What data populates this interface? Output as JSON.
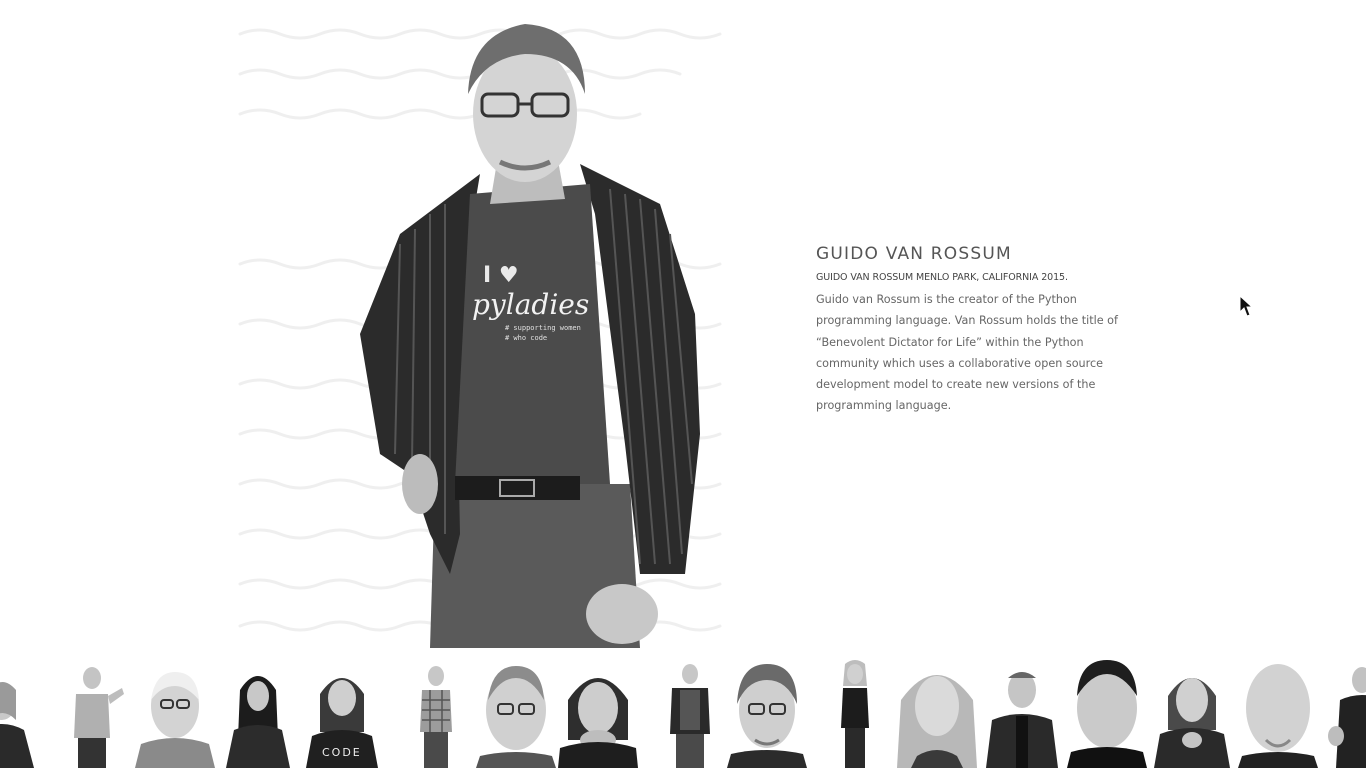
{
  "profile": {
    "name": "GUIDO VAN ROSSUM",
    "caption": "GUIDO VAN ROSSUM MENLO PARK, CALIFORNIA 2015.",
    "bio": "Guido van Rossum is the creator of the Python programming language. Van Rossum holds the title of “Benevolent Dictator for Life” within the Python community which uses a collaborative open source development model to create new versions of the programming language.",
    "shirt_text_top": "I ♥",
    "shirt_text_main": "pyladies",
    "shirt_text_sub1": "# supporting women",
    "shirt_text_sub2": "# who code"
  },
  "thumbnails": [
    {
      "name": "portrait-thumb-1",
      "shot": "half-body",
      "shirt_text": ""
    },
    {
      "name": "portrait-thumb-2",
      "shot": "full-body",
      "shirt_text": ""
    },
    {
      "name": "portrait-thumb-3",
      "shot": "head",
      "shirt_text": ""
    },
    {
      "name": "portrait-thumb-4",
      "shot": "half-body",
      "shirt_text": ""
    },
    {
      "name": "portrait-thumb-5",
      "shot": "half-body",
      "shirt_text": "CODE"
    },
    {
      "name": "portrait-thumb-6",
      "shot": "full-body",
      "shirt_text": ""
    },
    {
      "name": "portrait-thumb-7",
      "shot": "head",
      "shirt_text": ""
    },
    {
      "name": "portrait-thumb-8",
      "shot": "head",
      "shirt_text": ""
    },
    {
      "name": "portrait-thumb-9",
      "shot": "full-body",
      "shirt_text": ""
    },
    {
      "name": "portrait-thumb-10",
      "shot": "head",
      "shirt_text": ""
    },
    {
      "name": "portrait-thumb-11",
      "shot": "full-body",
      "shirt_text": ""
    },
    {
      "name": "portrait-thumb-12",
      "shot": "head",
      "shirt_text": ""
    },
    {
      "name": "portrait-thumb-13",
      "shot": "half-body",
      "shirt_text": ""
    },
    {
      "name": "portrait-thumb-14",
      "shot": "head",
      "shirt_text": ""
    },
    {
      "name": "portrait-thumb-15",
      "shot": "half-body",
      "shirt_text": ""
    },
    {
      "name": "portrait-thumb-16",
      "shot": "head",
      "shirt_text": ""
    },
    {
      "name": "portrait-thumb-17",
      "shot": "half-body",
      "shirt_text": ""
    }
  ],
  "colors": {
    "background": "#ffffff",
    "name_text": "#555555",
    "bio_text": "#666666"
  },
  "icons": {
    "cursor": "arrow-cursor-icon"
  }
}
